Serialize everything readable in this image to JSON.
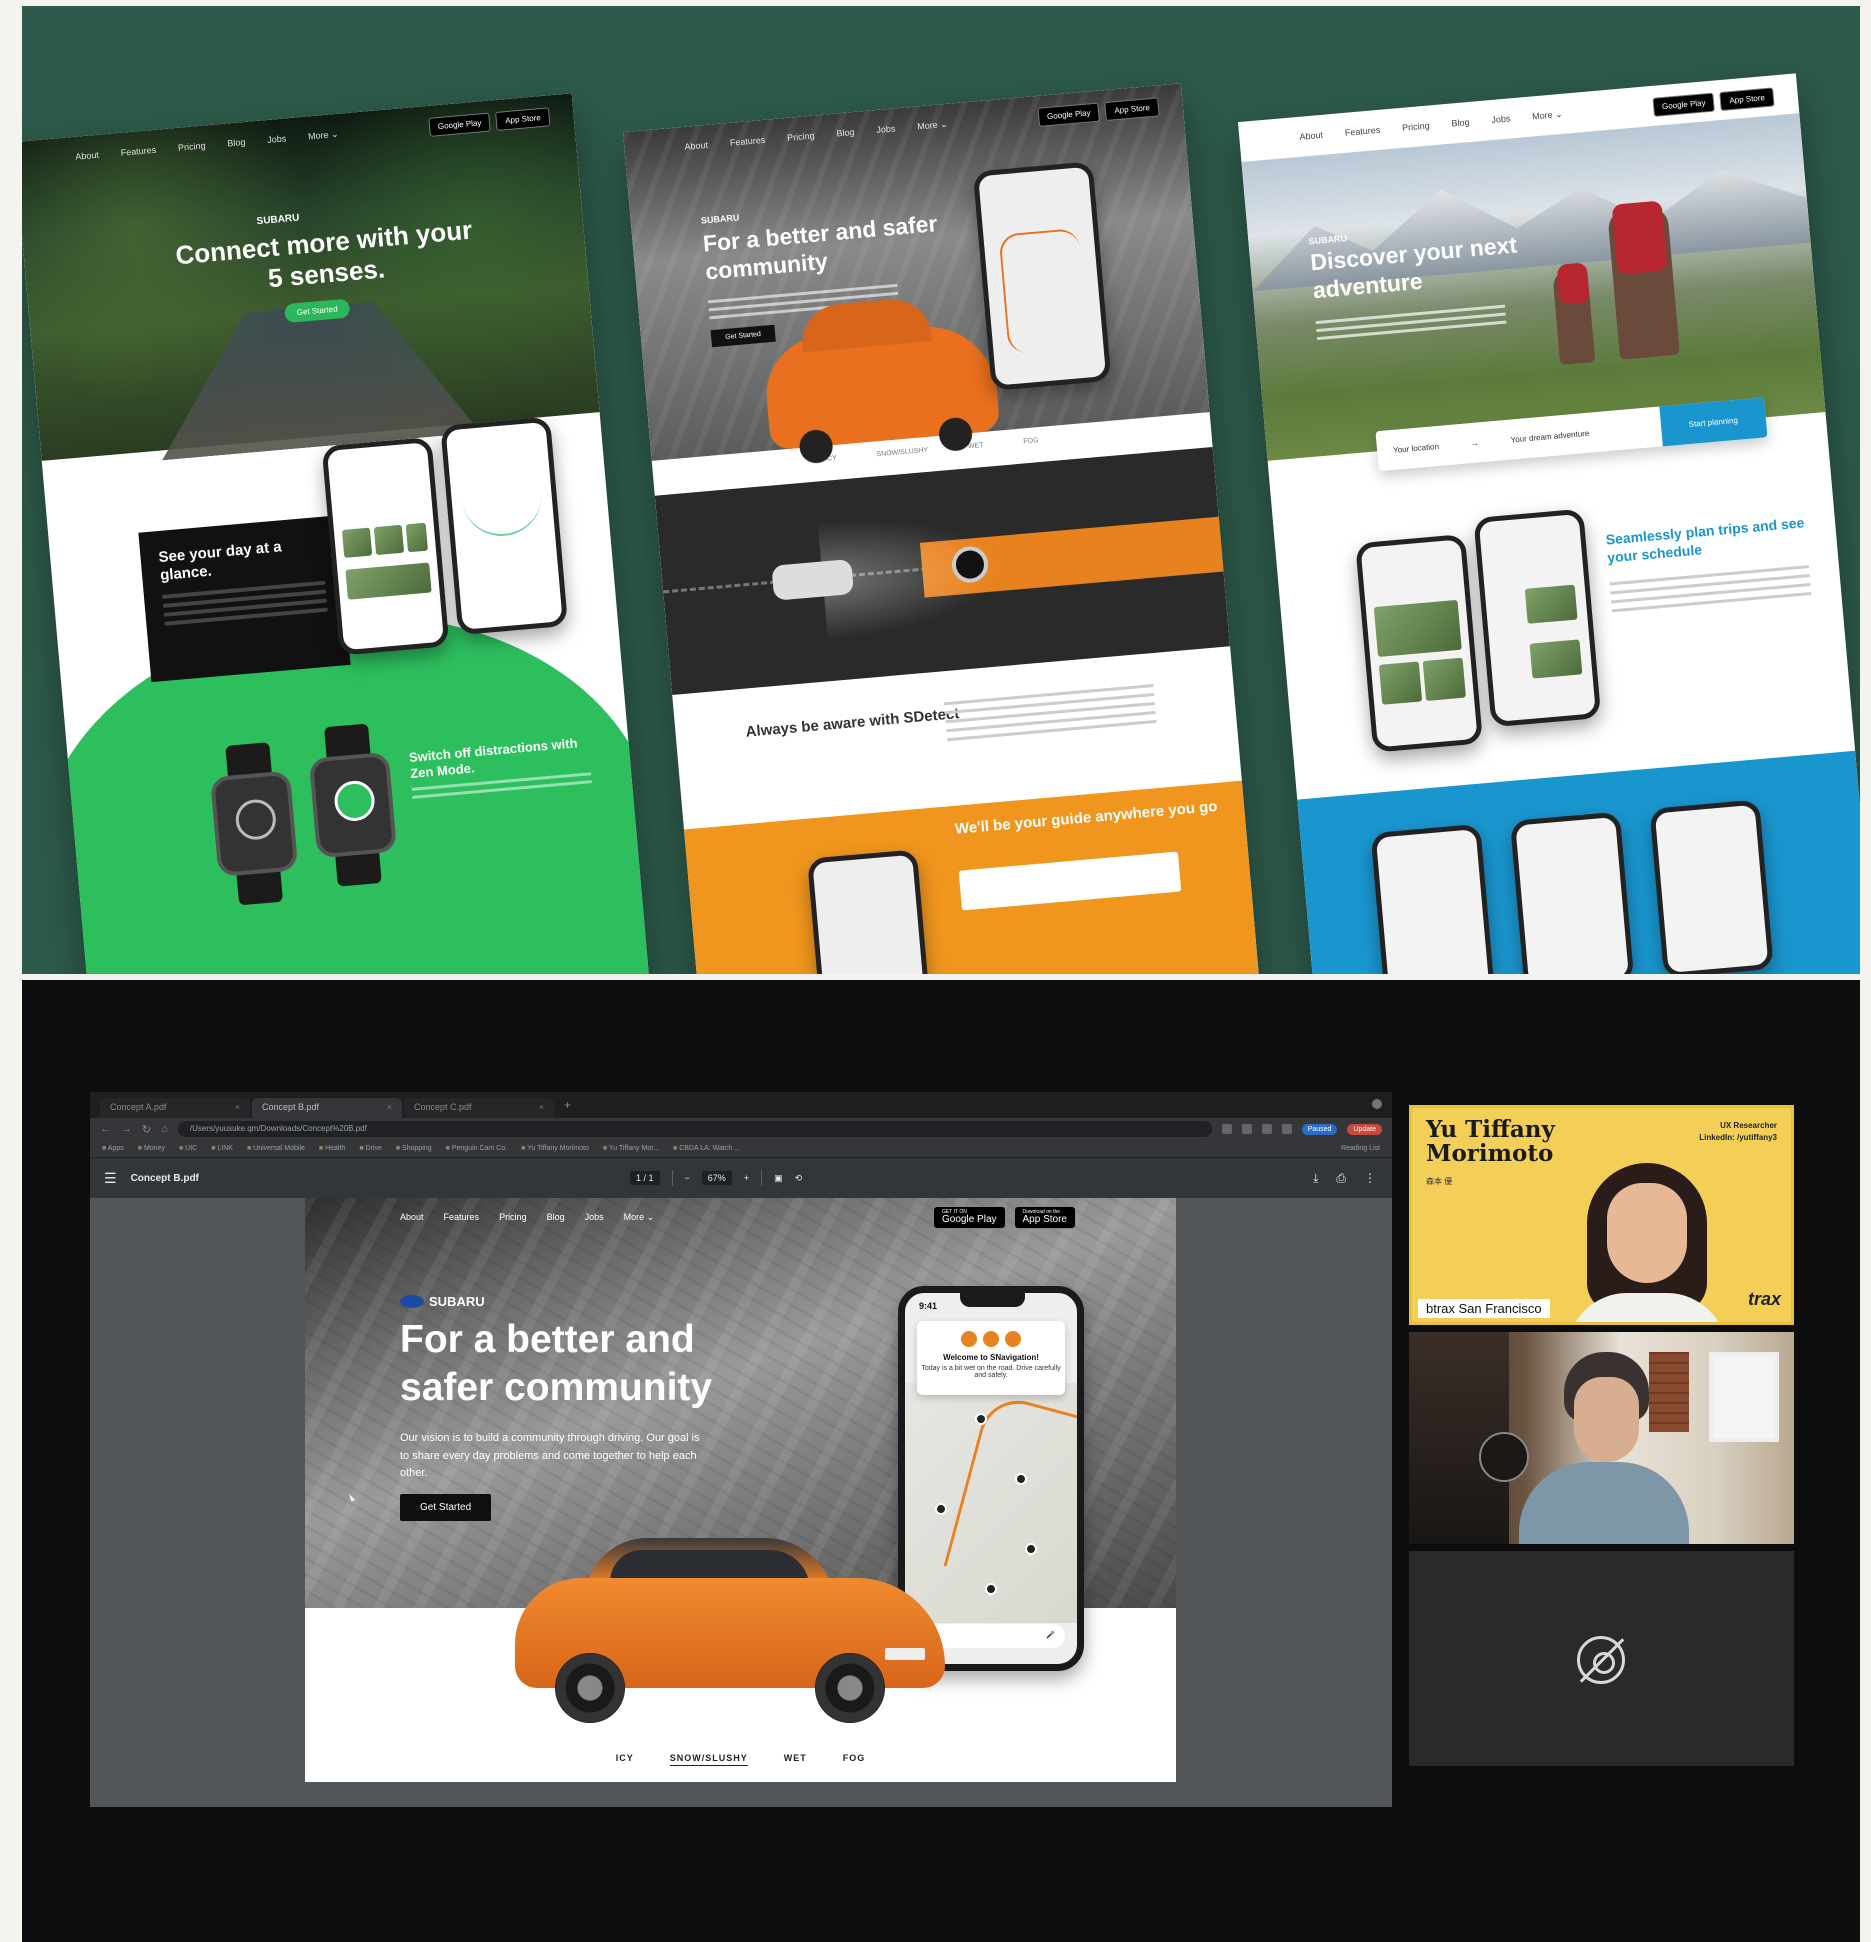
{
  "collage": {
    "mock1": {
      "nav": [
        "About",
        "Features",
        "Pricing",
        "Blog",
        "Jobs",
        "More ⌄"
      ],
      "stores": [
        "Google Play",
        "App Store"
      ],
      "brand": "SUBARU",
      "headline": "Connect more with your 5 senses.",
      "cta": "Get Started",
      "card_title": "See your day at a glance.",
      "zen_title": "Switch off distractions with Zen Mode."
    },
    "mock2": {
      "nav": [
        "About",
        "Features",
        "Pricing",
        "Blog",
        "Jobs",
        "More ⌄"
      ],
      "stores": [
        "Google Play",
        "App Store"
      ],
      "brand": "SUBARU",
      "headline": "For a better and safer community",
      "cta": "Get Started",
      "aware": "Always be aware with SDetect",
      "guide": "We'll be your guide anywhere you go"
    },
    "mock3": {
      "nav": [
        "About",
        "Features",
        "Pricing",
        "Blog",
        "Jobs",
        "More ⌄"
      ],
      "stores": [
        "Google Play",
        "App Store"
      ],
      "brand": "SUBARU",
      "headline": "Discover your next adventure",
      "search_from": "Your location",
      "search_arrow": "→",
      "search_to": "Your dream adventure",
      "search_cta": "Start planning",
      "plan_title": "Seamlessly plan trips and see your schedule"
    }
  },
  "browser": {
    "tabs": [
      {
        "label": "Concept A.pdf",
        "close": "×"
      },
      {
        "label": "Concept B.pdf",
        "close": "×"
      },
      {
        "label": "Concept C.pdf",
        "close": "×"
      }
    ],
    "new_tab": "+",
    "url": "/Users/yuusuke.qm/Downloads/Concept%20B.pdf",
    "profile_labels": [
      "Paused",
      "Update"
    ],
    "bookmarks": [
      "Apps",
      "Money",
      "UIC",
      "LINK",
      "Universal Mobile",
      "Health",
      "Drive",
      "Shopping",
      "Penguin Cam Co.",
      "Yu Tiffany Morimoto",
      "Yu Tiffany Mor...",
      "CBDA LA: Watch ..."
    ],
    "reading_list": "Reading List"
  },
  "pdf_viewer": {
    "menu_icon": "☰",
    "filename": "Concept B.pdf",
    "page_indicator": "1 / 1",
    "zoom_out": "−",
    "zoom": "67%",
    "zoom_in": "+",
    "download_icon": "⤓",
    "print_icon": "⎙",
    "more_icon": "⋮"
  },
  "pdf_page": {
    "nav": [
      "About",
      "Features",
      "Pricing",
      "Blog",
      "Jobs",
      "More ⌄"
    ],
    "google_play_small": "GET IT ON",
    "google_play": "Google Play",
    "app_store_small": "Download on the",
    "app_store": "App Store",
    "brand": "SUBARU",
    "headline": "For a better and safer community",
    "description": "Our vision is to build a community through driving. Our goal is to share every day problems and come together to help each other.",
    "cta": "Get Started",
    "phone": {
      "time": "9:41",
      "welcome_title": "Welcome to SNavigation!",
      "welcome_text": "Today is a bit wet on the road. Drive carefully and safely.",
      "mic_icon": "🎤"
    },
    "weather_tabs": [
      "ICY",
      "SNOW/SLUSHY",
      "WET",
      "FOG"
    ],
    "selected_weather": "SNOW/SLUSHY"
  },
  "participants": [
    {
      "name": "Yu Tiffany Morimoto",
      "name_line1": "Yu Tiffany",
      "name_line2": "Morimoto",
      "japanese": "森本 優",
      "role": "UX Researcher",
      "linkedin": "LinkedIn: /yutiffany3",
      "company": "btrax San Francisco",
      "logo": "trax"
    },
    {
      "camera": "on"
    },
    {
      "camera": "off",
      "icon": "camera-off-icon"
    }
  ],
  "colors": {
    "collage_bg": "#2d5a4a",
    "subaru_orange": "#e8821e",
    "green_accent": "#2dbf5e",
    "blue_accent": "#1a96cf",
    "speaker_tile": "#f3cf58"
  }
}
